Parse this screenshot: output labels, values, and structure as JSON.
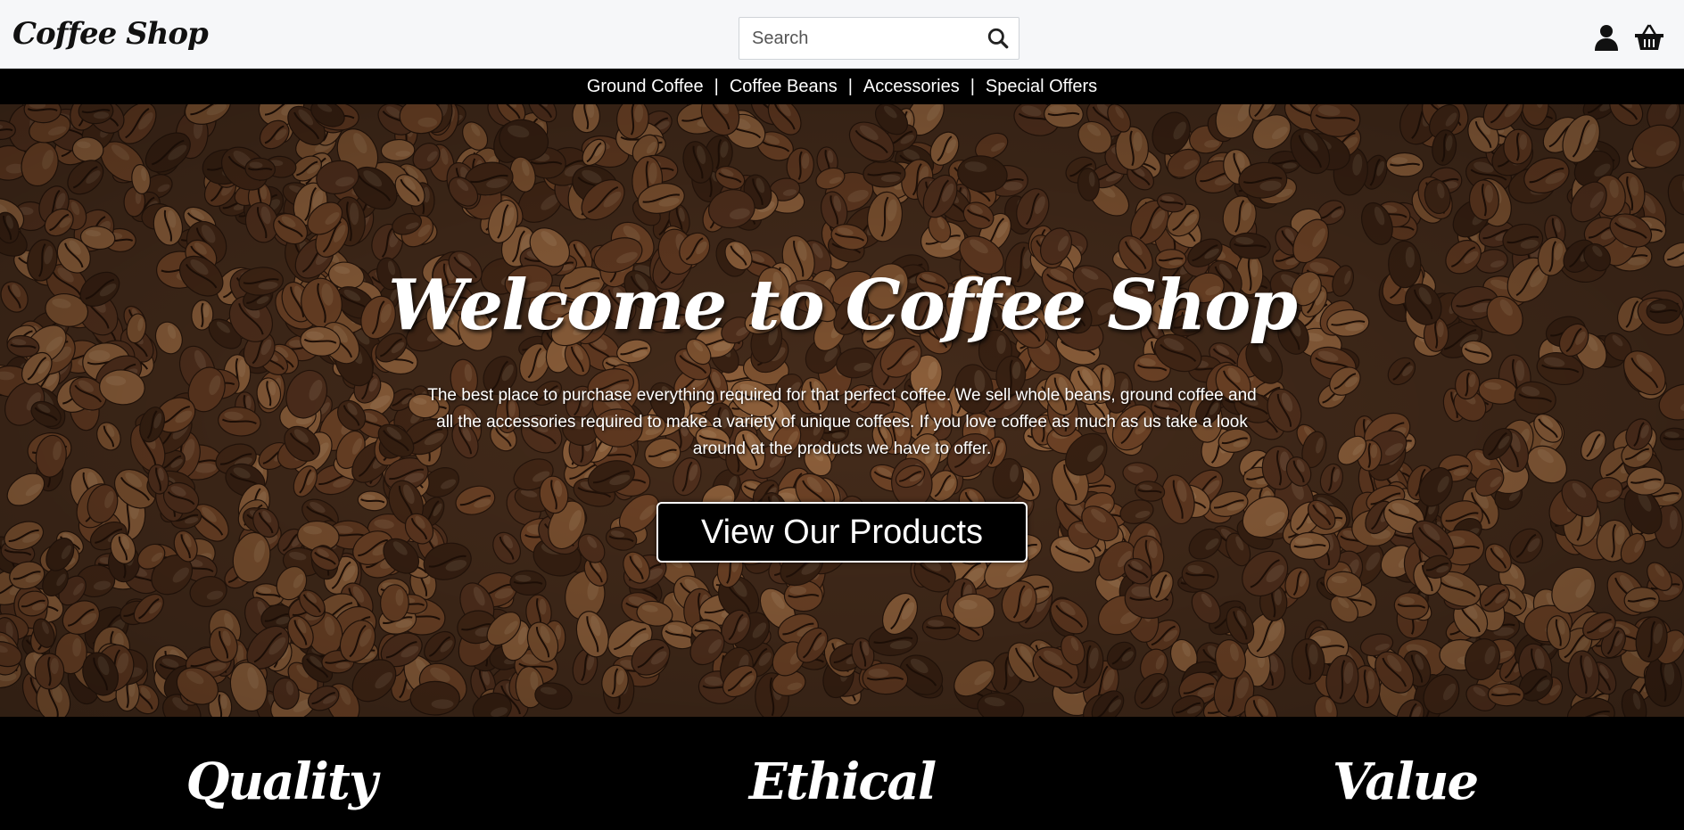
{
  "header": {
    "brand": "Coffee Shop",
    "search": {
      "placeholder": "Search"
    },
    "icons": [
      "search-icon",
      "user-icon",
      "basket-icon"
    ]
  },
  "nav": {
    "items": [
      {
        "label": "Ground Coffee"
      },
      {
        "label": "Coffee Beans"
      },
      {
        "label": "Accessories"
      },
      {
        "label": "Special Offers"
      }
    ],
    "separator": "|"
  },
  "hero": {
    "title": "Welcome to Coffee Shop",
    "description": "The best place to purchase everything required for that perfect coffee. We sell whole beans, ground coffee and all the accessories required to make a variety of unique coffees. If you love coffee as much as us take a look around at the products we have to offer.",
    "cta_label": "View Our Products"
  },
  "features": [
    {
      "title": "Quality"
    },
    {
      "title": "Ethical"
    },
    {
      "title": "Value"
    }
  ],
  "colors": {
    "header_bg": "#f6f7f9",
    "nav_bg": "#000000",
    "bean_brown": "#7a4a2a",
    "text_light": "#ffffff"
  }
}
